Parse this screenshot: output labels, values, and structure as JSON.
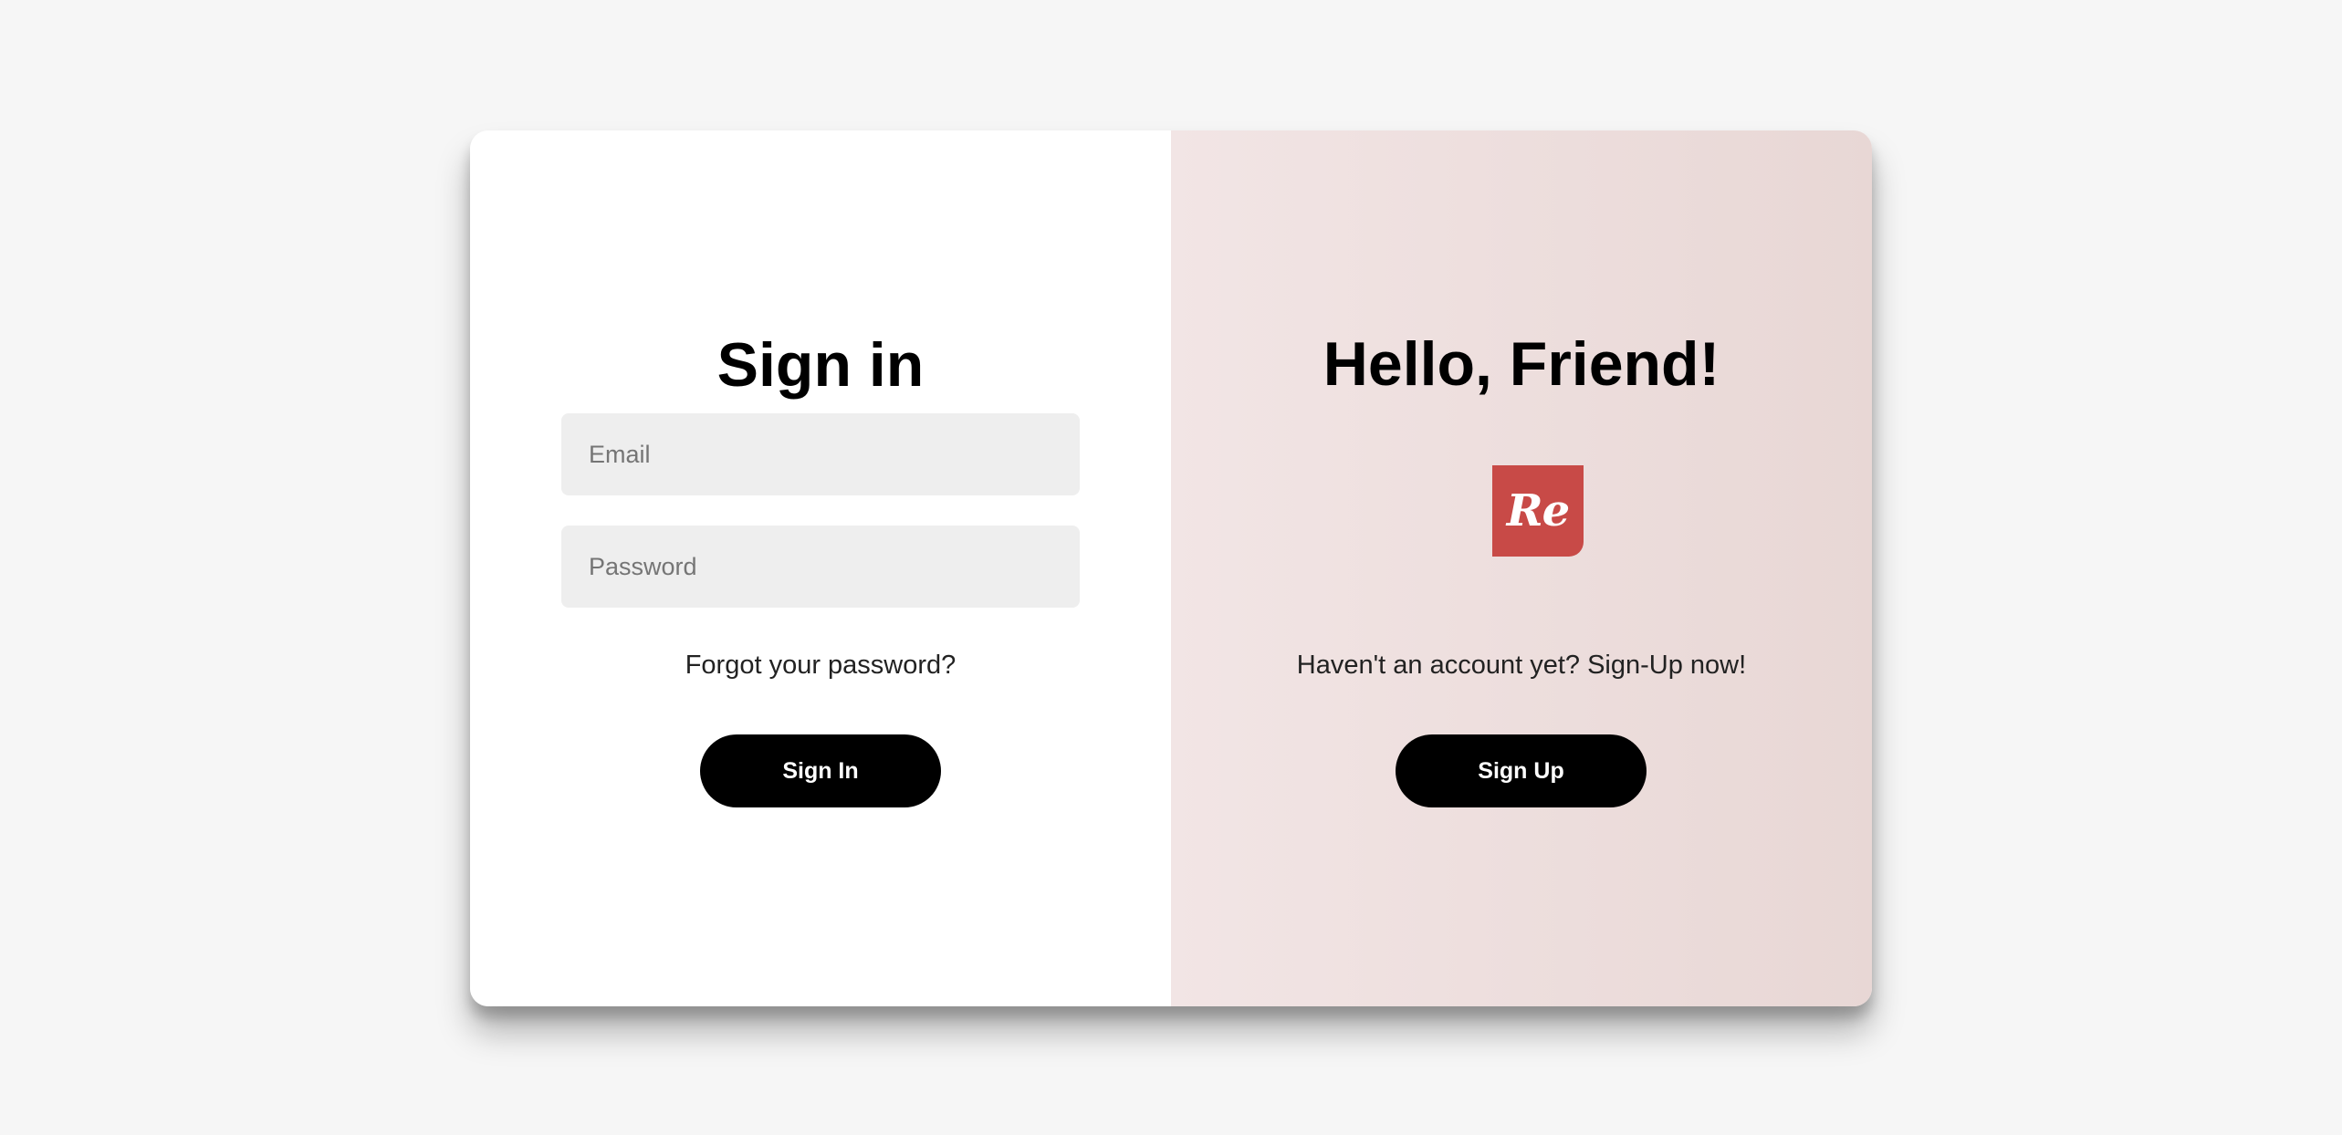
{
  "signin": {
    "title": "Sign in",
    "email_placeholder": "Email",
    "password_placeholder": "Password",
    "forgot_link": "Forgot your password?",
    "button_label": "Sign In"
  },
  "signup": {
    "title": "Hello, Friend!",
    "logo_text": "Re",
    "logo_color": "#c84a47",
    "prompt_text": "Haven't an account yet? Sign-Up now!",
    "button_label": "Sign Up"
  }
}
